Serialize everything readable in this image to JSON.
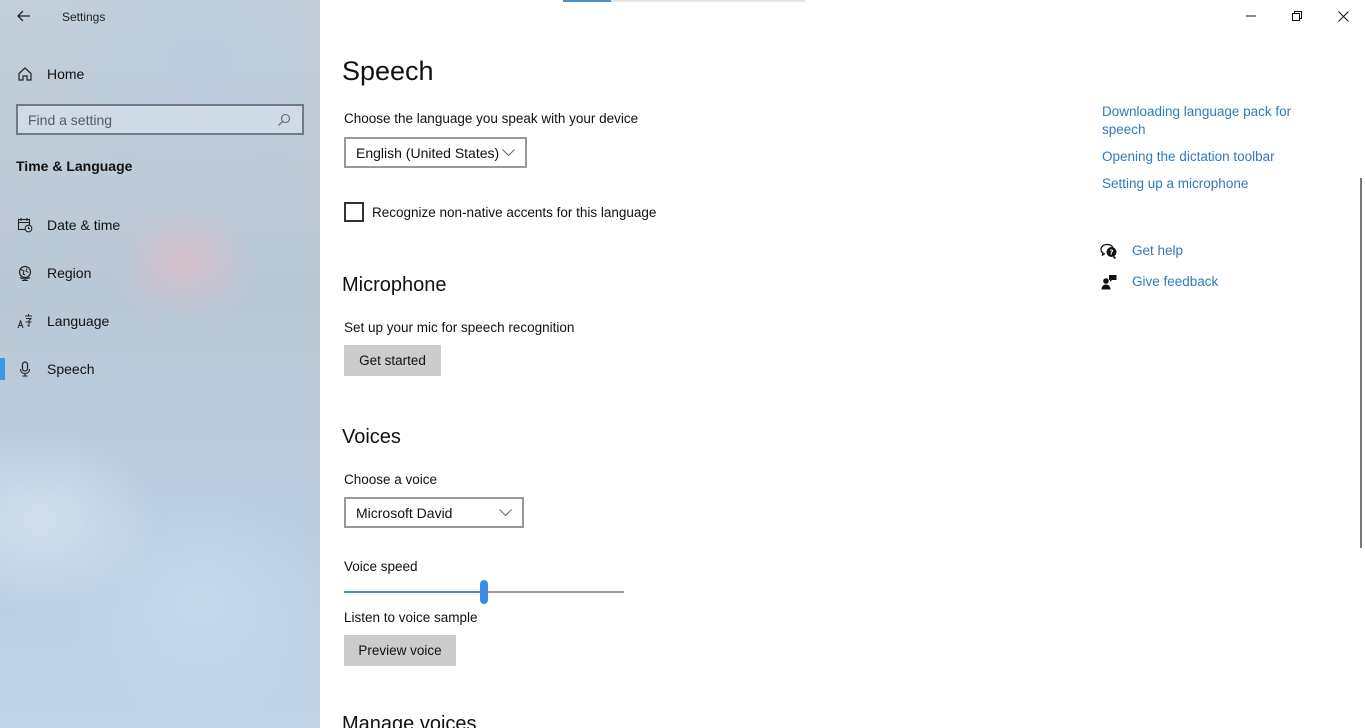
{
  "window": {
    "title": "Settings",
    "controls": {
      "minimize": "minimize",
      "restore": "restore",
      "close": "close"
    },
    "load_progress": 0.2
  },
  "sidebar": {
    "back_icon": "back-arrow-icon",
    "home": {
      "label": "Home",
      "icon": "home-icon"
    },
    "search": {
      "placeholder": "Find a setting",
      "value": "",
      "icon": "search-icon"
    },
    "section": "Time & Language",
    "items": [
      {
        "label": "Date & time",
        "icon": "calendar-clock-icon",
        "active": false
      },
      {
        "label": "Region",
        "icon": "globe-icon",
        "active": false
      },
      {
        "label": "Language",
        "icon": "language-icon",
        "active": false
      },
      {
        "label": "Speech",
        "icon": "microphone-icon",
        "active": true
      }
    ],
    "accent_color": "#3a96e6"
  },
  "main": {
    "title": "Speech",
    "language": {
      "label": "Choose the language you speak with your device",
      "selected": "English (United States)"
    },
    "accents_checkbox": {
      "label": "Recognize non-native accents for this language",
      "checked": false
    },
    "microphone": {
      "heading": "Microphone",
      "label": "Set up your mic for speech recognition",
      "button": "Get started"
    },
    "voices": {
      "heading": "Voices",
      "choose_label": "Choose a voice",
      "selected_voice": "Microsoft David",
      "speed_label": "Voice speed",
      "speed_value": 0.5,
      "sample_label": "Listen to voice sample",
      "preview_button": "Preview voice"
    },
    "manage_heading": "Manage voices"
  },
  "related": {
    "links": [
      "Downloading language pack for speech",
      "Opening the dictation toolbar",
      "Setting up a microphone"
    ],
    "get_help": {
      "label": "Get help",
      "icon": "help-chat-icon"
    },
    "give_feedback": {
      "label": "Give feedback",
      "icon": "feedback-icon"
    },
    "link_color": "#2f7bbd"
  }
}
